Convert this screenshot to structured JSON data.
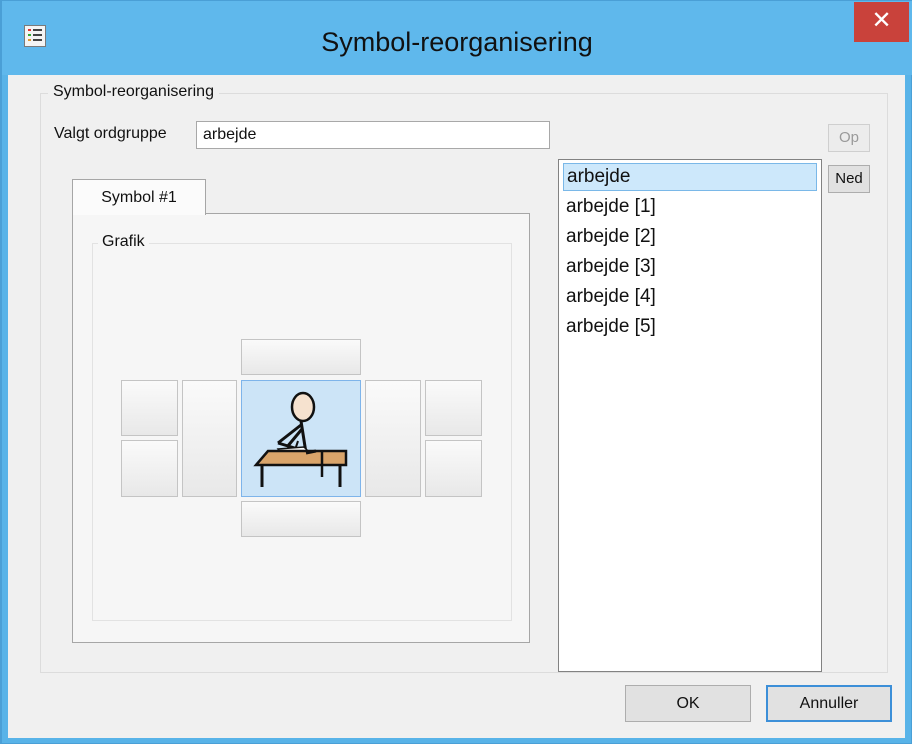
{
  "window": {
    "title": "Symbol-reorganisering",
    "close_label": "✕",
    "titlebar_color": "#5fb8ec",
    "close_color": "#c9423b"
  },
  "group": {
    "legend": "Symbol-reorganisering"
  },
  "word_group": {
    "label": "Valgt ordgruppe",
    "value": "arbejde"
  },
  "buttons": {
    "up_label": "Op",
    "down_label": "Ned",
    "ok_label": "OK",
    "cancel_label": "Annuller"
  },
  "tabs": [
    {
      "label": "Symbol #1",
      "selected": true
    }
  ],
  "grafik": {
    "legend": "Grafik",
    "image_icon": "person-writing-at-desk-icon"
  },
  "symbol_list": {
    "selected_index": 0,
    "items": [
      {
        "label": "arbejde"
      },
      {
        "label": "arbejde [1]"
      },
      {
        "label": "arbejde [2]"
      },
      {
        "label": "arbejde [3]"
      },
      {
        "label": "arbejde [4]"
      },
      {
        "label": "arbejde [5]"
      }
    ],
    "selection_color": "#cde8fb"
  }
}
